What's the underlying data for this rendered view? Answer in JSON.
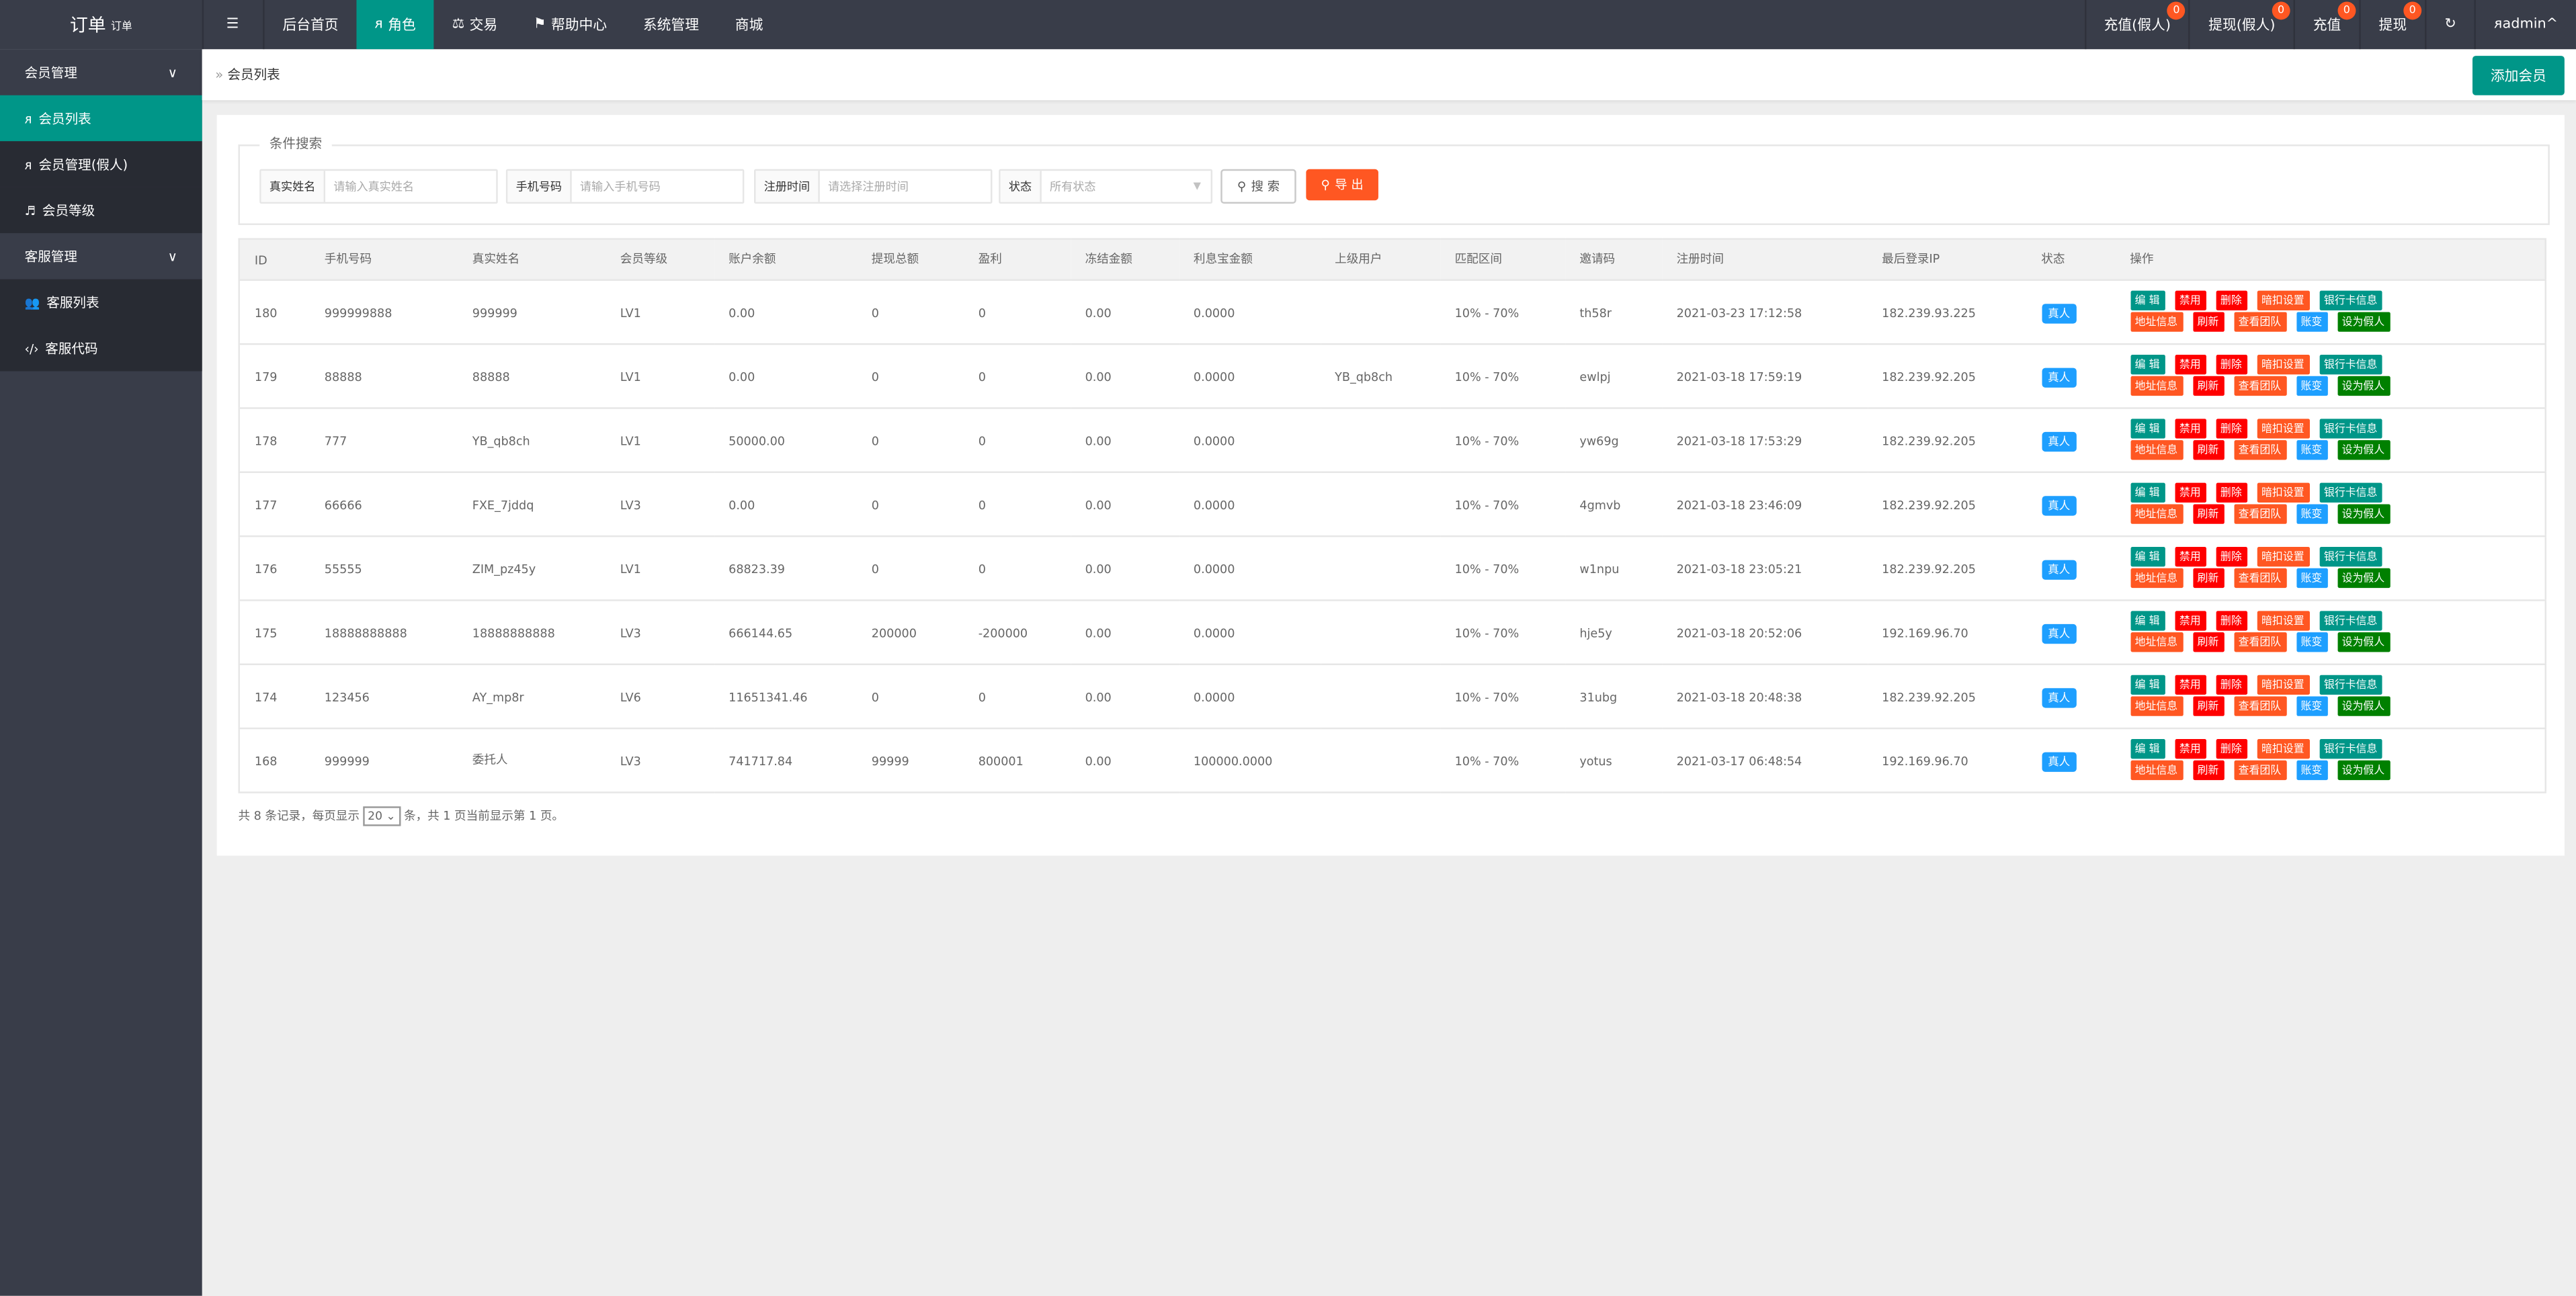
{
  "header": {
    "logo": "订单",
    "logo_sup": "订单",
    "nav": [
      {
        "label": "后台首页",
        "icon": ""
      },
      {
        "label": "角色",
        "icon": "user-icon",
        "active": true
      },
      {
        "label": "交易",
        "icon": "scale-icon"
      },
      {
        "label": "帮助中心",
        "icon": "flag-icon"
      },
      {
        "label": "系统管理",
        "icon": ""
      },
      {
        "label": "商城",
        "icon": ""
      }
    ],
    "right": [
      {
        "label": "充值(假人)",
        "badge": "0"
      },
      {
        "label": "提现(假人)",
        "badge": "0"
      },
      {
        "label": "充值",
        "badge": "0"
      },
      {
        "label": "提现",
        "badge": "0"
      }
    ],
    "user": "admin"
  },
  "sidebar": {
    "groups": [
      {
        "label": "会员管理",
        "items": [
          {
            "label": "会员列表",
            "icon": "user-icon",
            "active": true
          },
          {
            "label": "会员管理(假人)",
            "icon": "user-icon"
          },
          {
            "label": "会员等级",
            "icon": "level-icon"
          }
        ]
      },
      {
        "label": "客服管理",
        "items": [
          {
            "label": "客服列表",
            "icon": "users-icon"
          },
          {
            "label": "客服代码",
            "icon": "code-icon"
          }
        ]
      }
    ]
  },
  "breadcrumb": "会员列表",
  "add_button": "添加会员",
  "search": {
    "legend": "条件搜索",
    "name": {
      "label": "真实姓名",
      "placeholder": "请输入真实姓名"
    },
    "phone": {
      "label": "手机号码",
      "placeholder": "请输入手机号码"
    },
    "time": {
      "label": "注册时间",
      "placeholder": "请选择注册时间"
    },
    "status": {
      "label": "状态",
      "value": "所有状态"
    },
    "search_btn": "搜 索",
    "export_btn": "导 出"
  },
  "table": {
    "headers": [
      "ID",
      "手机号码",
      "真实姓名",
      "会员等级",
      "账户余额",
      "提现总额",
      "盈利",
      "冻结金额",
      "利息宝金额",
      "上级用户",
      "匹配区间",
      "邀请码",
      "注册时间",
      "最后登录IP",
      "状态",
      "操作"
    ],
    "rows": [
      [
        "180",
        "999999888",
        "999999",
        "LV1",
        "0.00",
        "0",
        "0",
        "0.00",
        "0.0000",
        "",
        "10% - 70%",
        "th58r",
        "2021-03-23 17:12:58",
        "182.239.93.225",
        "真人"
      ],
      [
        "179",
        "88888",
        "88888",
        "LV1",
        "0.00",
        "0",
        "0",
        "0.00",
        "0.0000",
        "YB_qb8ch",
        "10% - 70%",
        "ewlpj",
        "2021-03-18 17:59:19",
        "182.239.92.205",
        "真人"
      ],
      [
        "178",
        "777",
        "YB_qb8ch",
        "LV1",
        "50000.00",
        "0",
        "0",
        "0.00",
        "0.0000",
        "",
        "10% - 70%",
        "yw69g",
        "2021-03-18 17:53:29",
        "182.239.92.205",
        "真人"
      ],
      [
        "177",
        "66666",
        "FXE_7jddq",
        "LV3",
        "0.00",
        "0",
        "0",
        "0.00",
        "0.0000",
        "",
        "10% - 70%",
        "4gmvb",
        "2021-03-18 23:46:09",
        "182.239.92.205",
        "真人"
      ],
      [
        "176",
        "55555",
        "ZIM_pz45y",
        "LV1",
        "68823.39",
        "0",
        "0",
        "0.00",
        "0.0000",
        "",
        "10% - 70%",
        "w1npu",
        "2021-03-18 23:05:21",
        "182.239.92.205",
        "真人"
      ],
      [
        "175",
        "18888888888",
        "18888888888",
        "LV3",
        "666144.65",
        "200000",
        "-200000",
        "0.00",
        "0.0000",
        "",
        "10% - 70%",
        "hje5y",
        "2021-03-18 20:52:06",
        "192.169.96.70",
        "真人"
      ],
      [
        "174",
        "123456",
        "AY_mp8r",
        "LV6",
        "11651341.46",
        "0",
        "0",
        "0.00",
        "0.0000",
        "",
        "10% - 70%",
        "31ubg",
        "2021-03-18 20:48:38",
        "182.239.92.205",
        "真人"
      ],
      [
        "168",
        "999999",
        "委托人",
        "LV3",
        "741717.84",
        "99999",
        "800001",
        "0.00",
        "100000.0000",
        "",
        "10% - 70%",
        "yotus",
        "2021-03-17 06:48:54",
        "192.169.96.70",
        "真人"
      ]
    ],
    "actions": [
      {
        "label": "编 辑",
        "color": "#009688"
      },
      {
        "label": "禁用",
        "color": "#ff0000"
      },
      {
        "label": "删除",
        "color": "#ff0000"
      },
      {
        "label": "暗扣设置",
        "color": "#ff5722"
      },
      {
        "label": "银行卡信息",
        "color": "#009688"
      },
      {
        "label": "地址信息",
        "color": "#ff5722",
        "br": true
      },
      {
        "label": "刷新",
        "color": "#ff0000"
      },
      {
        "label": "查看团队",
        "color": "#ff5722"
      },
      {
        "label": "账变",
        "color": "#1e9fff"
      },
      {
        "label": "设为假人",
        "color": "#008000"
      }
    ]
  },
  "pagination": {
    "pre": "共 8 条记录，每页显示",
    "page_size": "20",
    "post": "条，共 1 页当前显示第 1 页。"
  },
  "colors": {
    "topbar": "#393d49",
    "accent": "#009688",
    "danger": "#ff0000",
    "warm": "#ff5722",
    "info": "#1e9fff"
  }
}
